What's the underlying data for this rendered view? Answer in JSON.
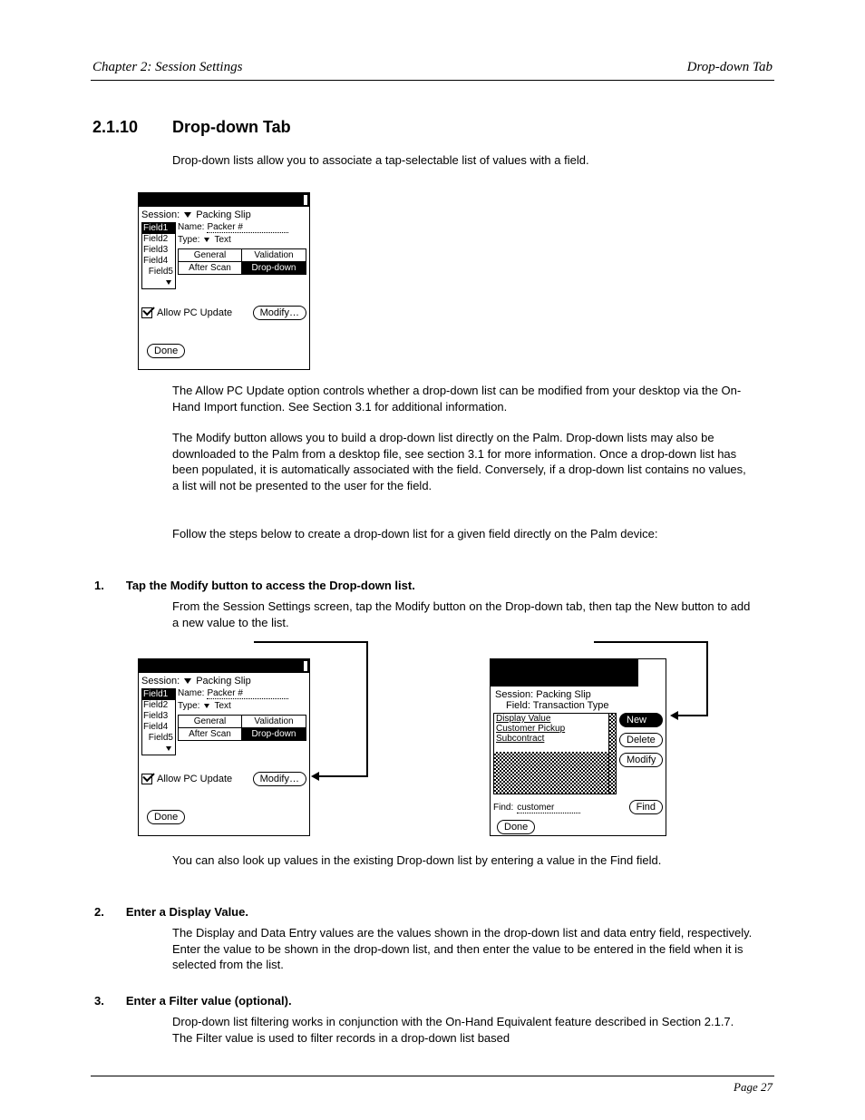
{
  "header": {
    "left": "Chapter 2: Session Settings",
    "right": "Drop-down Tab",
    "section_number": "2.1.10",
    "section_title": "Drop-down Tab",
    "intro": "Drop-down lists allow you to associate a tap-selectable list of values with a field."
  },
  "palm": {
    "session_label": "Session:",
    "session_value": "Packing Slip",
    "fields": [
      "Field1",
      "Field2",
      "Field3",
      "Field4",
      "Field5"
    ],
    "name_label": "Name:",
    "name_value": "Packer #",
    "type_label": "Type:",
    "type_value": "Text",
    "tabs": {
      "general": "General",
      "validation": "Validation",
      "afterscan": "After Scan",
      "dropdown": "Drop-down"
    },
    "allow_pc": "Allow PC Update",
    "modify": "Modify…",
    "done": "Done"
  },
  "body": {
    "para_a": "The Allow PC Update option controls whether a drop-down list can be modified from your desktop via the On-Hand Import function. See Section 3.1 for additional information.",
    "para_b": "The Modify button allows you to build a drop-down list directly on the Palm. Drop-down lists may also be downloaded to the Palm from a desktop file, see section 3.1 for more information. Once a drop-down list has been populated, it is automatically associated with the field. Conversely, if a drop-down list contains no values, a list will not be presented to the user for the field.",
    "para_c": "Follow the steps below to create a drop-down list for a given field directly on the Palm device:",
    "step1_title": "Tap the Modify button to access the Drop-down list.",
    "step1_sub": "From the Session Settings screen, tap the Modify button on the Drop-down tab, then tap the New button to add a new value to the list.",
    "para_d": "You can also look up values in the existing Drop-down list by entering a value in the Find field.",
    "step2_title": "Enter a Display Value.",
    "step2_sub": "The Display and Data Entry values are the values shown in the drop-down list and data entry field, respectively. Enter the value to be shown in the drop-down list, and then enter the value to be entered in the field when it is selected from the list.",
    "step3_title": "Enter a Filter value (optional).",
    "step3_sub1": "Drop-down list filtering works in conjunction with the On-Hand Equivalent feature described in Section 2.1.7. The Filter value is used to filter records in a drop-down list based"
  },
  "p3": {
    "session": "Session:  Packing Slip",
    "field": "Field:  Transaction Type",
    "list_header": "Display Value",
    "rows": [
      "Customer Pickup",
      "Subcontract"
    ],
    "new": "New",
    "delete": "Delete",
    "modify": "Modify",
    "find_label": "Find:",
    "find_value": "customer",
    "find_btn": "Find",
    "done": "Done"
  },
  "steps": {
    "s1": "1.",
    "s2": "2.",
    "s3": "3."
  },
  "footer": "Page 27"
}
